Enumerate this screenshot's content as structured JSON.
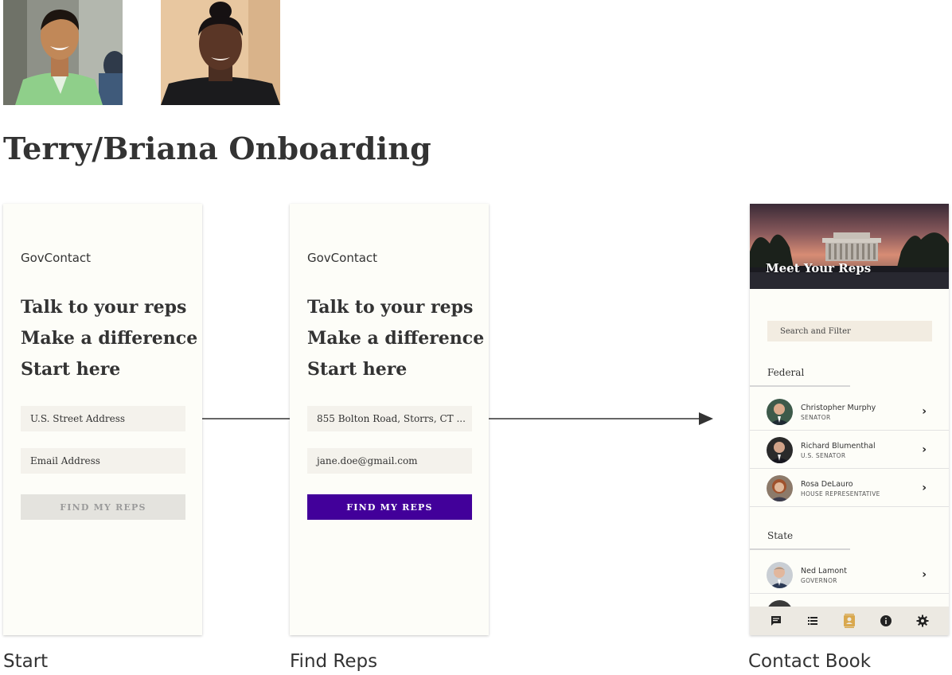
{
  "page": {
    "title": "Terry/Briana Onboarding",
    "personas": [
      {
        "icon": "persona-photo-terry"
      },
      {
        "icon": "persona-photo-briana"
      }
    ]
  },
  "screens": {
    "start": {
      "app_name": "GovContact",
      "tagline": [
        "Talk to your reps",
        "Make a difference",
        "Start here"
      ],
      "address_placeholder": "U.S. Street Address",
      "email_placeholder": "Email Address",
      "button_label": "FIND MY REPS",
      "step_label": "Start"
    },
    "find": {
      "app_name": "GovContact",
      "tagline": [
        "Talk to your reps",
        "Make a difference",
        "Start here"
      ],
      "address_value": "855 Bolton Road, Storrs, CT ...",
      "email_value": "jane.doe@gmail.com",
      "button_label": "FIND MY REPS",
      "step_label": "Find Reps"
    },
    "contact": {
      "hero_title": "Meet Your Reps",
      "search_placeholder": "Search and Filter",
      "federal_heading": "Federal",
      "federal_reps": [
        {
          "name": "Christopher Murphy",
          "title": "SENATOR"
        },
        {
          "name": "Richard Blumenthal",
          "title": "U.S. SENATOR"
        },
        {
          "name": "Rosa DeLauro",
          "title": "HOUSE REPRESENTATIVE"
        }
      ],
      "state_heading": "State",
      "state_reps": [
        {
          "name": "Ned Lamont",
          "title": "GOVERNOR"
        }
      ],
      "tabs": [
        {
          "icon": "chat-icon"
        },
        {
          "icon": "list-icon"
        },
        {
          "icon": "contact-book-icon"
        },
        {
          "icon": "info-icon"
        },
        {
          "icon": "settings-icon"
        }
      ],
      "step_label": "Contact Book"
    }
  },
  "colors": {
    "primary_button": "#42009a",
    "disabled_button": "#e4e3de",
    "active_tab": "#d9a84e"
  }
}
